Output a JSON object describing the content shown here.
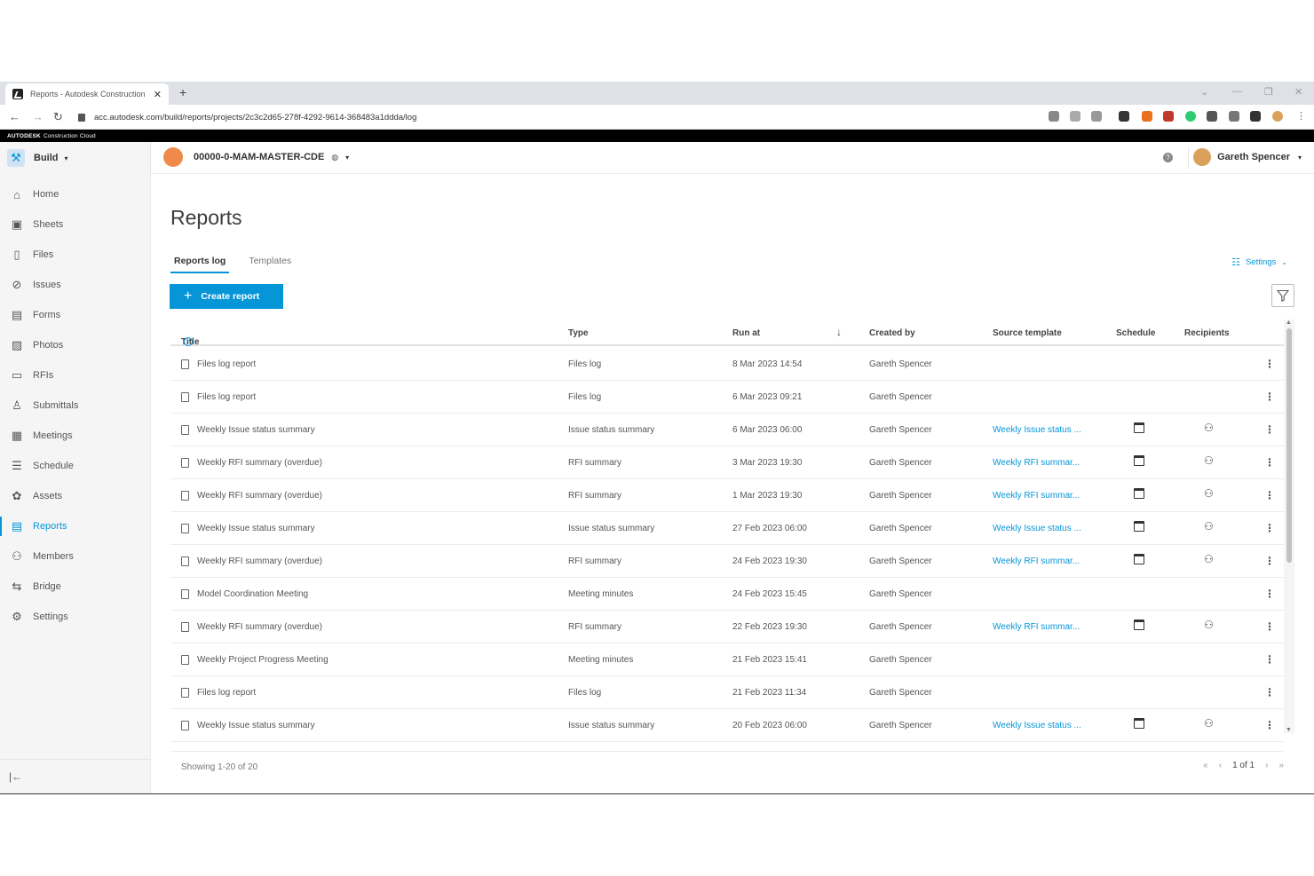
{
  "browser": {
    "tab_title": "Reports - Autodesk Construction",
    "url": "acc.autodesk.com/build/reports/projects/2c3c2d65-278f-4292-9614-368483a1ddda/log"
  },
  "brand": {
    "name": "AUTODESK",
    "product": "Construction Cloud"
  },
  "header": {
    "module": "Build",
    "project": "00000-0-MAM-MASTER-CDE",
    "user": "Gareth Spencer"
  },
  "sidebar": {
    "items": [
      {
        "label": "Home",
        "icon": "home-icon"
      },
      {
        "label": "Sheets",
        "icon": "sheets-icon"
      },
      {
        "label": "Files",
        "icon": "files-icon"
      },
      {
        "label": "Issues",
        "icon": "issues-icon"
      },
      {
        "label": "Forms",
        "icon": "forms-icon"
      },
      {
        "label": "Photos",
        "icon": "photos-icon"
      },
      {
        "label": "RFIs",
        "icon": "rfis-icon"
      },
      {
        "label": "Submittals",
        "icon": "submittals-icon"
      },
      {
        "label": "Meetings",
        "icon": "meetings-icon"
      },
      {
        "label": "Schedule",
        "icon": "schedule-icon"
      },
      {
        "label": "Assets",
        "icon": "assets-icon"
      },
      {
        "label": "Reports",
        "icon": "reports-icon",
        "active": true
      },
      {
        "label": "Members",
        "icon": "members-icon"
      },
      {
        "label": "Bridge",
        "icon": "bridge-icon"
      },
      {
        "label": "Settings",
        "icon": "settings-icon"
      }
    ]
  },
  "main": {
    "title": "Reports",
    "tabs": [
      "Reports log",
      "Templates"
    ],
    "settings_label": "Settings",
    "create_label": "Create report",
    "columns": {
      "title": "Title",
      "type": "Type",
      "run_at": "Run at",
      "created_by": "Created by",
      "source_template": "Source template",
      "schedule": "Schedule",
      "recipients": "Recipients"
    },
    "rows": [
      {
        "title": "Files log report",
        "type": "Files log",
        "run_at": "8 Mar 2023 14:54",
        "created_by": "Gareth Spencer",
        "source": "",
        "scheduled": false
      },
      {
        "title": "Files log report",
        "type": "Files log",
        "run_at": "6 Mar 2023 09:21",
        "created_by": "Gareth Spencer",
        "source": "",
        "scheduled": false
      },
      {
        "title": "Weekly Issue status summary",
        "type": "Issue status summary",
        "run_at": "6 Mar 2023 06:00",
        "created_by": "Gareth Spencer",
        "source": "Weekly Issue status ...",
        "scheduled": true
      },
      {
        "title": "Weekly RFI summary (overdue)",
        "type": "RFI summary",
        "run_at": "3 Mar 2023 19:30",
        "created_by": "Gareth Spencer",
        "source": "Weekly RFI summar...",
        "scheduled": true
      },
      {
        "title": "Weekly RFI summary (overdue)",
        "type": "RFI summary",
        "run_at": "1 Mar 2023 19:30",
        "created_by": "Gareth Spencer",
        "source": "Weekly RFI summar...",
        "scheduled": true
      },
      {
        "title": "Weekly Issue status summary",
        "type": "Issue status summary",
        "run_at": "27 Feb 2023 06:00",
        "created_by": "Gareth Spencer",
        "source": "Weekly Issue status ...",
        "scheduled": true
      },
      {
        "title": "Weekly RFI summary (overdue)",
        "type": "RFI summary",
        "run_at": "24 Feb 2023 19:30",
        "created_by": "Gareth Spencer",
        "source": "Weekly RFI summar...",
        "scheduled": true
      },
      {
        "title": "Model Coordination Meeting",
        "type": "Meeting minutes",
        "run_at": "24 Feb 2023 15:45",
        "created_by": "Gareth Spencer",
        "source": "",
        "scheduled": false
      },
      {
        "title": "Weekly RFI summary (overdue)",
        "type": "RFI summary",
        "run_at": "22 Feb 2023 19:30",
        "created_by": "Gareth Spencer",
        "source": "Weekly RFI summar...",
        "scheduled": true
      },
      {
        "title": "Weekly Project Progress Meeting",
        "type": "Meeting minutes",
        "run_at": "21 Feb 2023 15:41",
        "created_by": "Gareth Spencer",
        "source": "",
        "scheduled": false
      },
      {
        "title": "Files log report",
        "type": "Files log",
        "run_at": "21 Feb 2023 11:34",
        "created_by": "Gareth Spencer",
        "source": "",
        "scheduled": false
      },
      {
        "title": "Weekly Issue status summary",
        "type": "Issue status summary",
        "run_at": "20 Feb 2023 06:00",
        "created_by": "Gareth Spencer",
        "source": "Weekly Issue status ...",
        "scheduled": true
      }
    ],
    "showing": "Showing 1-20 of 20",
    "page_label": "1 of 1"
  },
  "colors": {
    "accent": "#0696d7",
    "sidebar_bg": "#f5f5f5"
  }
}
